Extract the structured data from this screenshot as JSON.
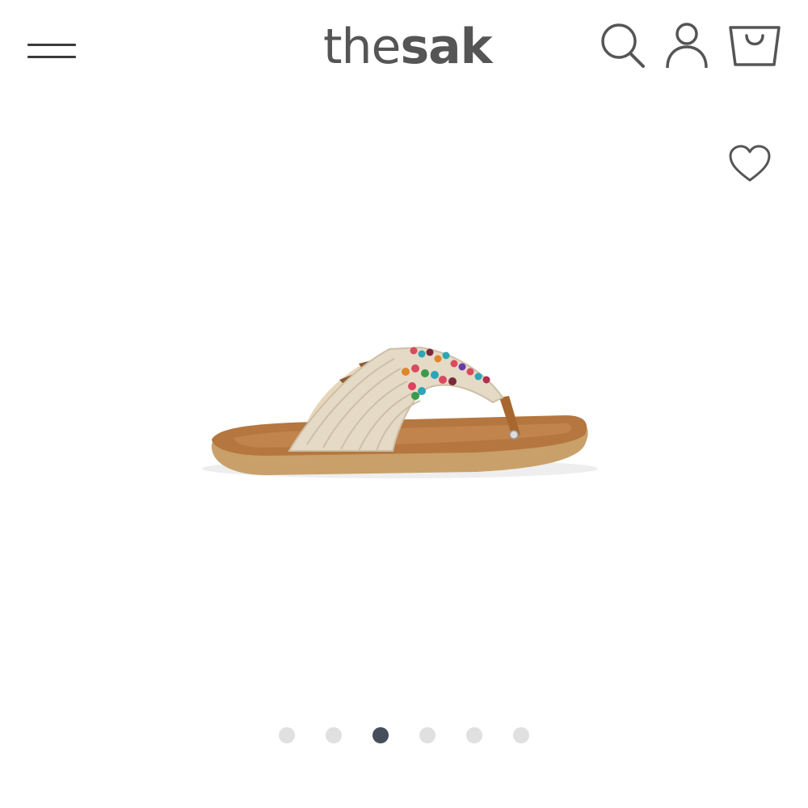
{
  "header": {
    "logo": {
      "prefix": "the",
      "suffix": "sak"
    },
    "icons": {
      "menu": "hamburger-menu-icon",
      "search": "search-icon",
      "account": "user-icon",
      "cart": "shopping-bag-icon"
    }
  },
  "product": {
    "wishlist_icon": "heart-icon",
    "image": "beaded-crochet-thong-sandal"
  },
  "gallery": {
    "total": 6,
    "active_index": 2
  },
  "colors": {
    "icon": "#555555",
    "dot": "#e0e0e0",
    "dot_active": "#464e5c"
  }
}
